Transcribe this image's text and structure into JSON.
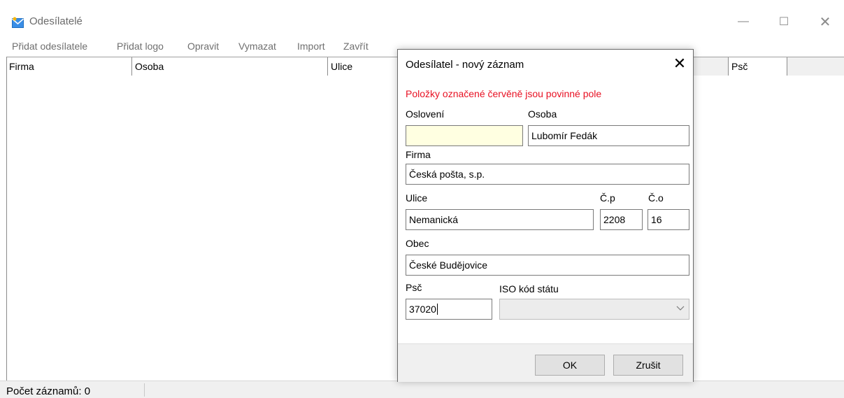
{
  "window": {
    "title": "Odesílatelé",
    "controls": {
      "minimize": "—",
      "maximize": "☐",
      "close": "✕"
    }
  },
  "menu": {
    "items": [
      "Přidat odesílatele",
      "Přidat logo",
      "Opravit",
      "Vymazat",
      "Import",
      "Zavřít"
    ]
  },
  "grid": {
    "columns": [
      "Firma",
      "Osoba",
      "Ulice",
      "Psč"
    ],
    "rows": []
  },
  "status": {
    "count_text": "Počet záznamů: 0"
  },
  "dialog": {
    "title": "Odesílatel - nový záznam",
    "close": "✕",
    "required_note": "Položky označené červěně jsou povinné pole",
    "fields": {
      "osloveni": {
        "label": "Oslovení",
        "value": ""
      },
      "osoba": {
        "label": "Osoba",
        "value": "Lubomír Fedák"
      },
      "firma": {
        "label": "Firma",
        "value": "Česká pošta, s.p."
      },
      "ulice": {
        "label": "Ulice",
        "value": "Nemanická"
      },
      "cp": {
        "label": "Č.p",
        "value": "2208"
      },
      "co": {
        "label": "Č.o",
        "value": "16"
      },
      "obec": {
        "label": "Obec",
        "value": "České Budějovice"
      },
      "psc": {
        "label": "Psč",
        "value": "37020"
      },
      "iso": {
        "label": "ISO kód státu",
        "value": ""
      }
    },
    "buttons": {
      "ok": "OK",
      "cancel": "Zrušit"
    }
  },
  "colors": {
    "required": "#e81123",
    "highlight_field": "#ffffe1"
  },
  "icons": {
    "app": "mail-envelope-icon",
    "dropdown": "chevron-down-icon"
  }
}
